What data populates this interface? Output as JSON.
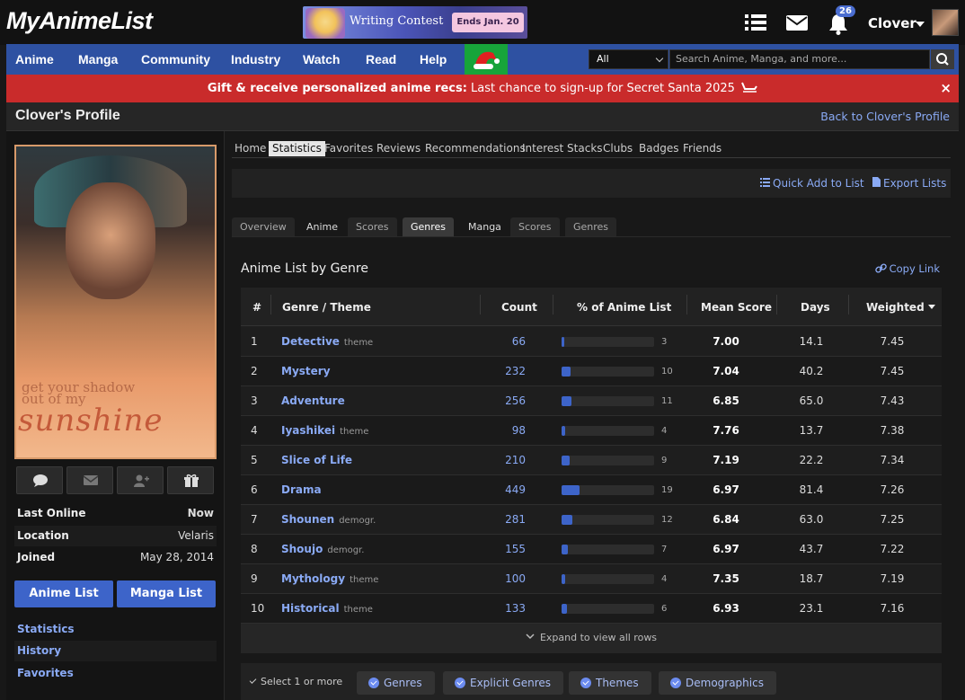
{
  "header": {
    "logo": "MyAnimeList",
    "banner": {
      "title": "Writing Contest",
      "ends": "Ends Jan. 20"
    },
    "notification_count": "26",
    "user_name": "Clover"
  },
  "nav": {
    "items": [
      "Anime",
      "Manga",
      "Community",
      "Industry",
      "Watch",
      "Read",
      "Help"
    ],
    "search_category": "All",
    "search_placeholder": "Search Anime, Manga, and more..."
  },
  "promo": {
    "bold": "Gift & receive personalized anime recs:",
    "text": " Last chance to sign-up for Secret Santa 2025",
    "close": "×"
  },
  "profile": {
    "title": "Clover's Profile",
    "back_link": "Back to Clover's Profile",
    "pic_text1": "get your shadow out of my",
    "pic_text2": "sunshine",
    "info": [
      {
        "key": "Last Online",
        "value": "Now"
      },
      {
        "key": "Location",
        "value": "Velaris"
      },
      {
        "key": "Joined",
        "value": "May 28, 2014"
      }
    ],
    "anime_list_btn": "Anime List",
    "manga_list_btn": "Manga List",
    "side_links": [
      "Statistics",
      "History",
      "Favorites"
    ]
  },
  "subnav": [
    "Home",
    "Statistics",
    "Favorites",
    "Reviews",
    "Recommendations",
    "Interest Stacks",
    "Clubs",
    "Badges",
    "Friends"
  ],
  "toolbar": {
    "quick_add": "Quick Add to List",
    "export": "Export Lists"
  },
  "stat_tabs": [
    "Overview",
    "Anime",
    "Scores",
    "Genres",
    "Manga",
    "Scores",
    "Genres"
  ],
  "genre_table": {
    "title": "Anime List by Genre",
    "copy_link": "Copy Link",
    "headers": [
      "#",
      "Genre / Theme",
      "Count",
      "% of Anime List",
      "Mean Score",
      "Days",
      "Weighted"
    ],
    "rows": [
      {
        "rank": "1",
        "name": "Detective",
        "tag": "theme",
        "count": "66",
        "pct": 3,
        "pct_label": "3",
        "mean": "7.00",
        "days": "14.1",
        "weighted": "7.45"
      },
      {
        "rank": "2",
        "name": "Mystery",
        "tag": "",
        "count": "232",
        "pct": 10,
        "pct_label": "10",
        "mean": "7.04",
        "days": "40.2",
        "weighted": "7.45"
      },
      {
        "rank": "3",
        "name": "Adventure",
        "tag": "",
        "count": "256",
        "pct": 11,
        "pct_label": "11",
        "mean": "6.85",
        "days": "65.0",
        "weighted": "7.43"
      },
      {
        "rank": "4",
        "name": "Iyashikei",
        "tag": "theme",
        "count": "98",
        "pct": 4,
        "pct_label": "4",
        "mean": "7.76",
        "days": "13.7",
        "weighted": "7.38"
      },
      {
        "rank": "5",
        "name": "Slice of Life",
        "tag": "",
        "count": "210",
        "pct": 9,
        "pct_label": "9",
        "mean": "7.19",
        "days": "22.2",
        "weighted": "7.34"
      },
      {
        "rank": "6",
        "name": "Drama",
        "tag": "",
        "count": "449",
        "pct": 19,
        "pct_label": "19",
        "mean": "6.97",
        "days": "81.4",
        "weighted": "7.26"
      },
      {
        "rank": "7",
        "name": "Shounen",
        "tag": "demogr.",
        "count": "281",
        "pct": 12,
        "pct_label": "12",
        "mean": "6.84",
        "days": "63.0",
        "weighted": "7.25"
      },
      {
        "rank": "8",
        "name": "Shoujo",
        "tag": "demogr.",
        "count": "155",
        "pct": 7,
        "pct_label": "7",
        "mean": "6.97",
        "days": "43.7",
        "weighted": "7.22"
      },
      {
        "rank": "9",
        "name": "Mythology",
        "tag": "theme",
        "count": "100",
        "pct": 4,
        "pct_label": "4",
        "mean": "7.35",
        "days": "18.7",
        "weighted": "7.19"
      },
      {
        "rank": "10",
        "name": "Historical",
        "tag": "theme",
        "count": "133",
        "pct": 6,
        "pct_label": "6",
        "mean": "6.93",
        "days": "23.1",
        "weighted": "7.16"
      }
    ],
    "expand": "Expand to view all rows"
  },
  "filters": {
    "label": "Select 1 or more",
    "buttons": [
      "Genres",
      "Explicit Genres",
      "Themes",
      "Demographics"
    ]
  },
  "colors": {
    "nav": "#2e51a2",
    "promo": "#c92b2b",
    "accent": "#3d64c9",
    "link": "#8aaaf5"
  }
}
